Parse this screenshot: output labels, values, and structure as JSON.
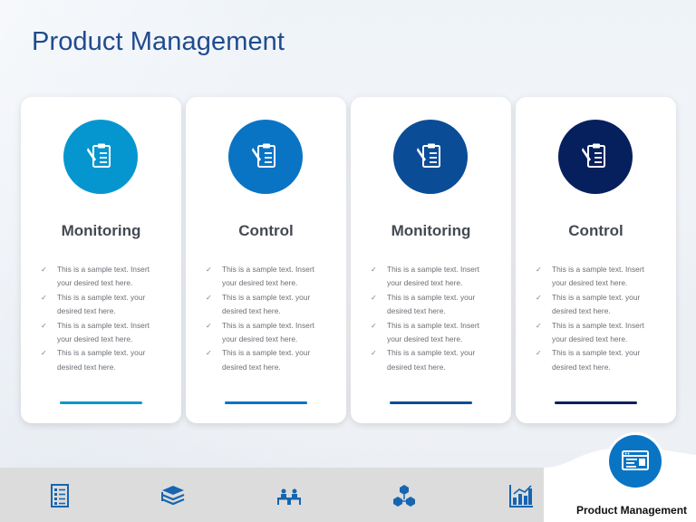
{
  "slide": {
    "title": "Product Management",
    "colors": {
      "title": "#1f4b8e",
      "card1": "#0696cf",
      "card2": "#0a74c4",
      "card3": "#0b4c97",
      "card4": "#06205e",
      "footer_bg": "#dcdcdc",
      "footer_icons": "#1665b0"
    }
  },
  "cards": [
    {
      "icon": "clipboard-pencil-icon",
      "heading": "Monitoring",
      "items": [
        "This is a sample text. Insert your desired text here.",
        "This is a sample text. your desired text here.",
        "This is a sample text. Insert your desired text here.",
        "This is a sample text. your desired text here."
      ]
    },
    {
      "icon": "clipboard-pencil-icon",
      "heading": "Control",
      "items": [
        "This is a sample text. Insert your desired text here.",
        "This is a sample text. your desired text here.",
        "This is a sample text. Insert your desired text here.",
        "This is a sample text. your desired text here."
      ]
    },
    {
      "icon": "clipboard-pencil-icon",
      "heading": "Monitoring",
      "items": [
        "This is a sample text. Insert your desired text here.",
        "This is a sample text. your desired text here.",
        "This is a sample text. Insert your desired text here.",
        "This is a sample text. your desired text here."
      ]
    },
    {
      "icon": "clipboard-pencil-icon",
      "heading": "Control",
      "items": [
        "This is a sample text. Insert your desired text here.",
        "This is a sample text. your desired text here.",
        "This is a sample text. Insert your desired text here.",
        "This is a sample text. your desired text here."
      ]
    }
  ],
  "footer": {
    "icons": [
      "checklist-icon",
      "stacked-books-icon",
      "meeting-table-icon",
      "cubes-network-icon",
      "bar-chart-icon"
    ],
    "badge_icon": "browser-window-icon",
    "label": "Product Management"
  }
}
